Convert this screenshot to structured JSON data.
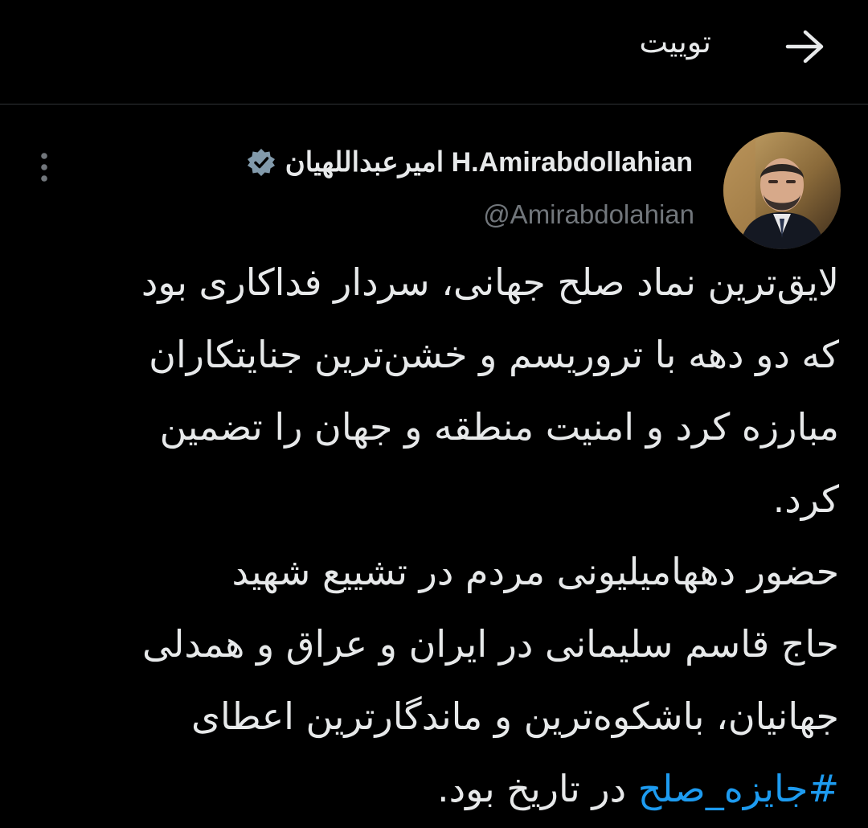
{
  "header": {
    "title": "توییت",
    "back_icon": "arrow-right-icon"
  },
  "tweet": {
    "author": {
      "display_name": "امیرعبداللهیان H.Amirabdollahian",
      "handle": "@Amirabdolahian",
      "verified_icon": "verified-badge-icon",
      "avatar_icon": "avatar"
    },
    "more_icon": "more-vertical-icon",
    "lines": [
      "لایق‌ترین نماد صلح جهانی، سردار فداکاری بود",
      "که دو دهه با تروریسم و خشن‌ترین جنایتکاران",
      "مبارزه کرد و امنیت منطقه و جهان را تضمین",
      "کرد.",
      "حضور دهها‌میلیونی مردم در تشییع شهید",
      "حاج قاسم سلیمانی در ایران و عراق و همدلی",
      "جهانیان، باشکوه‌ترین و ماندگارترین اعطای"
    ],
    "hashtag": "#جایزه_صلح",
    "last_line_rest": " در تاریخ بود."
  },
  "colors": {
    "background": "#000000",
    "text": "#e7e9ea",
    "secondary": "#71767b",
    "link": "#1d9bf0",
    "divider": "#2f3336",
    "verified_badge": "#829aab"
  }
}
